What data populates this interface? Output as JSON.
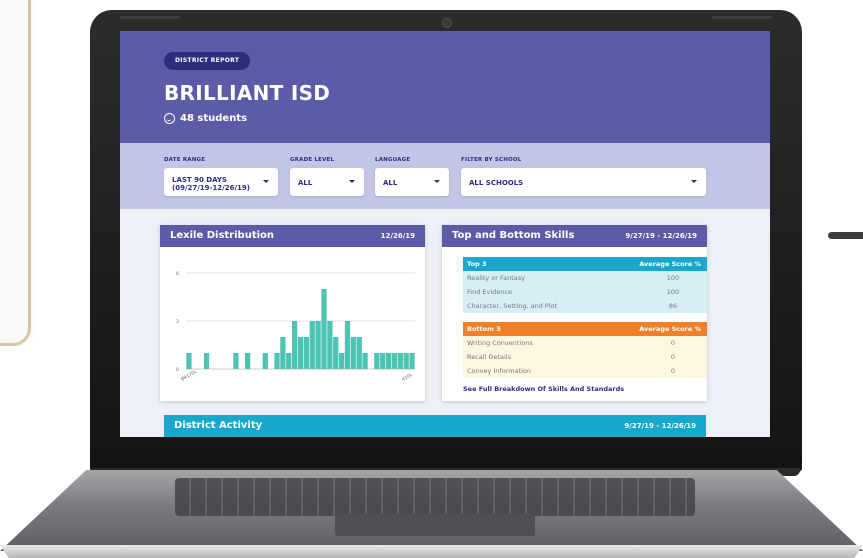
{
  "report": {
    "badge": "DISTRICT REPORT",
    "title": "BRILLIANT ISD",
    "students": "48 students"
  },
  "filters": [
    {
      "label": "DATE RANGE",
      "value_line1": "LAST 90 DAYS",
      "value_line2": "(09/27/19-12/26/19)"
    },
    {
      "label": "GRADE LEVEL",
      "value_line1": "ALL"
    },
    {
      "label": "LANGUAGE",
      "value_line1": "ALL"
    },
    {
      "label": "FILTER BY SCHOOL",
      "value_line1": "ALL SCHOOLS"
    }
  ],
  "lexile": {
    "title": "Lexile Distribution",
    "date": "12/26/19"
  },
  "chart_data": {
    "type": "bar",
    "title": "Lexile Distribution",
    "xlabel": "",
    "ylabel": "",
    "ylim": [
      0,
      6
    ],
    "yticks": [
      0,
      3,
      6
    ],
    "x_tick_labels": [
      "BR170L",
      "410L"
    ],
    "values": [
      1,
      0,
      0,
      1,
      0,
      0,
      0,
      0,
      1,
      0,
      1,
      0,
      0,
      1,
      0,
      1,
      2,
      1,
      3,
      2,
      2,
      3,
      3,
      5,
      3,
      2,
      1,
      3,
      2,
      2,
      1,
      0,
      1,
      1,
      1,
      1,
      1,
      1,
      1
    ],
    "color": "#4dc4b2",
    "grid": true
  },
  "skills": {
    "title": "Top and Bottom Skills",
    "date": "9/27/19 - 12/26/19",
    "top_header": "Top 3",
    "score_header": "Average Score %",
    "top": [
      {
        "name": "Reality or Fantasy",
        "score": "100"
      },
      {
        "name": "Find Evidence",
        "score": "100"
      },
      {
        "name": "Character, Setting, and Plot",
        "score": "86"
      }
    ],
    "bottom_header": "Bottom 3",
    "bottom": [
      {
        "name": "Writing Conventions",
        "score": "0"
      },
      {
        "name": "Recall Details",
        "score": "0"
      },
      {
        "name": "Convey Information",
        "score": "0"
      }
    ],
    "breakdown_link": "See Full Breakdown Of Skills And Standards"
  },
  "activity": {
    "title": "District Activity",
    "date": "9/27/19 - 12/26/19"
  },
  "colors": {
    "header": "#5b5ba8",
    "navy": "#2d2d80",
    "filterbar": "#c3c5e6",
    "teal": "#4dc4b2",
    "cyan": "#17a8cc",
    "orange": "#f17f29"
  }
}
